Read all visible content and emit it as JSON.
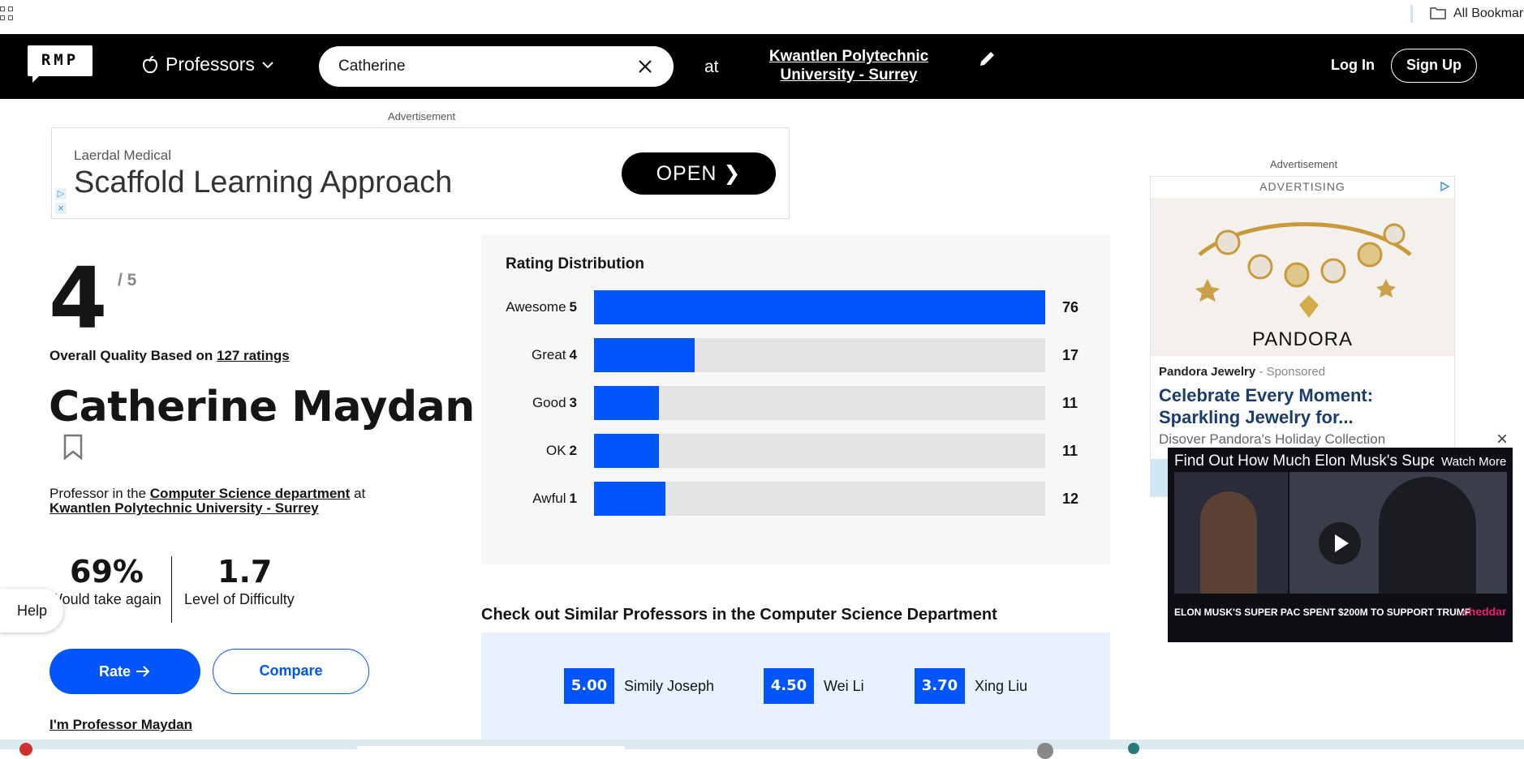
{
  "bookmarks_bar": {
    "all_bookmarks_label": "All Bookmarks"
  },
  "header": {
    "logo_text": "RMP",
    "nav_label": "Professors",
    "search": {
      "value": "Catherine"
    },
    "at_text": "at",
    "school_line1": "Kwantlen Polytechnic",
    "school_line2": "University - Surrey",
    "login_label": "Log In",
    "signup_label": "Sign Up"
  },
  "ad_top": {
    "label": "Advertisement",
    "brand": "Laerdal Medical",
    "headline": "Scaffold Learning Approach",
    "cta": "OPEN"
  },
  "professor": {
    "rating": "4",
    "rating_max": "/ 5",
    "quality_prefix": "Overall Quality Based on ",
    "ratings_count_text": "127 ratings",
    "name": "Catherine Maydan",
    "dept_prefix": "Professor in the ",
    "dept_link": "Computer Science department",
    "dept_mid": " at",
    "school_link": "Kwantlen Polytechnic University - Surrey",
    "would_take_again": "69%",
    "would_take_again_label": "Would take again",
    "difficulty": "1.7",
    "difficulty_label": "Level of Difficulty",
    "rate_label": "Rate",
    "compare_label": "Compare",
    "claim_label": "I'm Professor Maydan"
  },
  "help_label": "Help",
  "distribution": {
    "title": "Rating Distribution",
    "rows": [
      {
        "label": "Awesome",
        "level": "5",
        "count": 76
      },
      {
        "label": "Great",
        "level": "4",
        "count": 17
      },
      {
        "label": "Good",
        "level": "3",
        "count": 11
      },
      {
        "label": "OK",
        "level": "2",
        "count": 11
      },
      {
        "label": "Awful",
        "level": "1",
        "count": 12
      }
    ]
  },
  "similar": {
    "title": "Check out Similar Professors in the Computer Science Department",
    "items": [
      {
        "score": "5.00",
        "name": "Simily Joseph"
      },
      {
        "score": "4.50",
        "name": "Wei Li"
      },
      {
        "score": "3.70",
        "name": "Xing Liu"
      }
    ]
  },
  "ad_right": {
    "label": "Advertisement",
    "advertising": "ADVERTISING",
    "brand_logo": "PANDORA",
    "advertiser": "Pandora Jewelry",
    "sponsored": " - Sponsored",
    "headline": "Celebrate Every Moment: Sparkling Jewelry for...",
    "description": "Disover Pandora's Holiday Collection"
  },
  "video": {
    "title": "Find Out How Much Elon Musk's Super PAC Spent",
    "watch_more": "Watch More",
    "caption": "ELON MUSK'S SUPER PAC SPENT $200M TO SUPPORT TRUMP",
    "brand": "cheddar"
  },
  "colors": {
    "accent": "#0055fd",
    "header_bg": "#000000",
    "panel_bg": "#f7f7f7",
    "similar_bg": "#e7f1ff"
  }
}
